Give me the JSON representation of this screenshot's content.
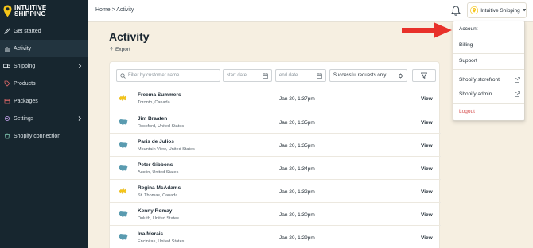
{
  "brand": {
    "line1": "INTUITIVE",
    "line2": "SHIPPING",
    "accent": "#f5c518"
  },
  "sidebar": {
    "items": [
      {
        "label": "Get started",
        "icon": "rocket-icon"
      },
      {
        "label": "Activity",
        "icon": "chart-icon",
        "active": true
      },
      {
        "label": "Shipping",
        "icon": "truck-icon",
        "has_children": true
      },
      {
        "label": "Products",
        "icon": "tag-icon"
      },
      {
        "label": "Packages",
        "icon": "box-icon"
      },
      {
        "label": "Settings",
        "icon": "gear-icon",
        "has_children": true
      },
      {
        "label": "Shopify connection",
        "icon": "shopify-icon"
      }
    ]
  },
  "topbar": {
    "breadcrumb": "Home > Activity",
    "user_label": "Intuitive Shipping"
  },
  "dropdown": {
    "items": [
      {
        "label": "Account"
      },
      {
        "label": "Billing"
      },
      {
        "label": "Support"
      },
      {
        "label": "Shopify storefront",
        "external": true
      },
      {
        "label": "Shopify admin",
        "external": true
      },
      {
        "label": "Logout"
      }
    ]
  },
  "main": {
    "title": "Activity",
    "export_label": "Export",
    "filters": {
      "search_placeholder": "Filter by customer name",
      "start_placeholder": "start date",
      "end_placeholder": "end date",
      "status_value": "Successful requests only"
    },
    "view_label": "View",
    "rows": [
      {
        "name": "Freema Summers",
        "location": "Toronto, Canada",
        "date": "Jan 20, 1:37pm",
        "country": "CA"
      },
      {
        "name": "Jim Braaten",
        "location": "Rockford, United States",
        "date": "Jan 20, 1:35pm",
        "country": "US"
      },
      {
        "name": "Paris de Julios",
        "location": "Mountain View, United States",
        "date": "Jan 20, 1:35pm",
        "country": "US"
      },
      {
        "name": "Peter Gibbons",
        "location": "Austin, United States",
        "date": "Jan 20, 1:34pm",
        "country": "US"
      },
      {
        "name": "Regina McAdams",
        "location": "St. Thomas, Canada",
        "date": "Jan 20, 1:32pm",
        "country": "CA"
      },
      {
        "name": "Kenny Romay",
        "location": "Duluth, United States",
        "date": "Jan 20, 1:30pm",
        "country": "US"
      },
      {
        "name": "Ina Morais",
        "location": "Encinitas, United States",
        "date": "Jan 20, 1:29pm",
        "country": "US"
      }
    ]
  },
  "colors": {
    "sidebar_bg": "#17262f",
    "page_bg": "#f6efe1",
    "arrow": "#e8312a",
    "logout": "#d64f4f"
  }
}
